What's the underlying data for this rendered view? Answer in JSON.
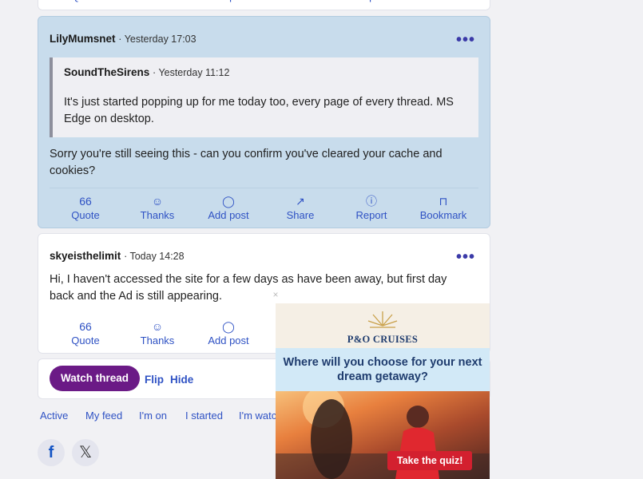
{
  "post_actions": {
    "quote": "Quote",
    "thanks": "Thanks",
    "add_post": "Add post",
    "share": "Share",
    "report": "Report",
    "bookmark": "Bookmark"
  },
  "post1": {
    "author": "LilyMumsnet",
    "time": "· Yesterday 17:03",
    "more": "•••",
    "quote_author": "SoundTheSirens",
    "quote_time": "· Yesterday 11:12",
    "quote_text": "It's just started popping up for me today too, every page of every thread. MS Edge on desktop.",
    "text": "Sorry you're still seeing this - can you confirm you've cleared your cache and cookies?"
  },
  "post2": {
    "author": "skyeisthelimit",
    "time": "· Today 14:28",
    "more": "•••",
    "text": "Hi, I haven't accessed the site for a few days as have been away, but first day back and the Ad is still appearing."
  },
  "thread_bar": {
    "watch": "Watch thread",
    "flip": "Flip",
    "hide": "Hide"
  },
  "nav_tabs": [
    "Active",
    "My feed",
    "I'm on",
    "I started",
    "I'm watc"
  ],
  "social": {
    "facebook": "f",
    "x": "𝕏"
  },
  "ad": {
    "close": "×",
    "brand": "P&O CRUISES",
    "headline": "Where will you choose for your next dream getaway?",
    "cta": "Take the quiz!"
  },
  "icons": {
    "quote": "66",
    "thanks": "☺",
    "add_post": "◯",
    "share": "↗",
    "report": "ⓘ",
    "bookmark": "⊓"
  }
}
